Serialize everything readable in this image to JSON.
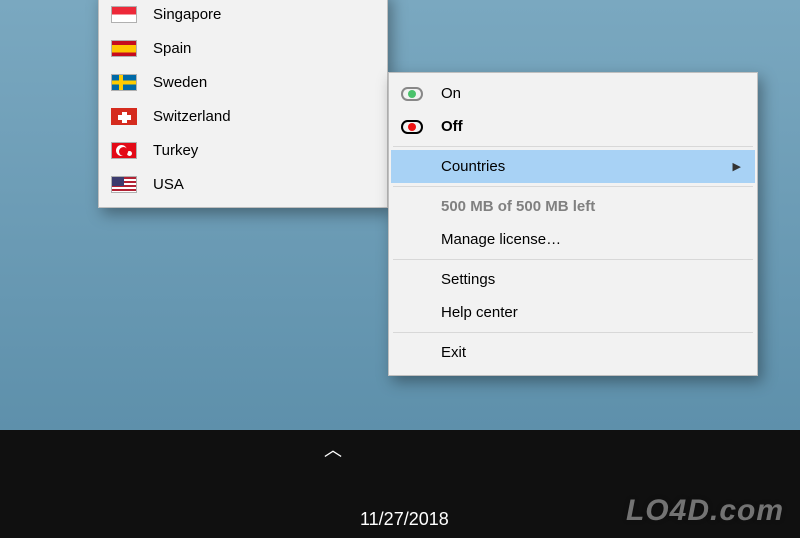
{
  "countries_menu": {
    "items": [
      {
        "label": "Singapore",
        "flag": "sg"
      },
      {
        "label": "Spain",
        "flag": "es"
      },
      {
        "label": "Sweden",
        "flag": "se"
      },
      {
        "label": "Switzerland",
        "flag": "ch"
      },
      {
        "label": "Turkey",
        "flag": "tr"
      },
      {
        "label": "USA",
        "flag": "us"
      }
    ]
  },
  "main_menu": {
    "on_label": "On",
    "off_label": "Off",
    "countries_label": "Countries",
    "quota_label": "500 MB of 500 MB left",
    "manage_license_label": "Manage license…",
    "settings_label": "Settings",
    "help_center_label": "Help center",
    "exit_label": "Exit"
  },
  "taskbar": {
    "date": "11/27/2018"
  },
  "watermark": "LO4D.com"
}
